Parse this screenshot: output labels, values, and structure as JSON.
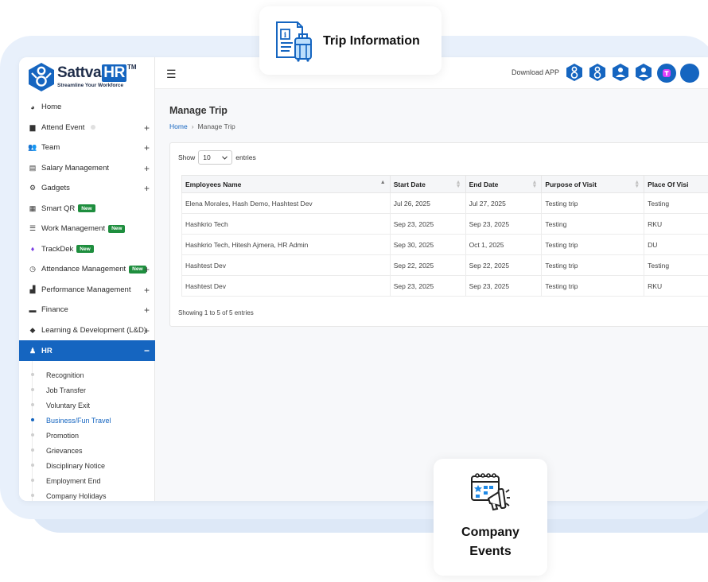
{
  "brand": {
    "name": "Sattva",
    "name_hr": "HR",
    "tm": "TM",
    "tagline": "Streamline Your Workforce"
  },
  "topbar": {
    "download_label": "Download APP"
  },
  "sidebar": {
    "items": [
      {
        "label": "Home",
        "icon": "dashboard-icon",
        "plus": ""
      },
      {
        "label": "Attend Event",
        "icon": "calendar-icon",
        "plus": "+"
      },
      {
        "label": "Team",
        "icon": "users-icon",
        "plus": "+"
      },
      {
        "label": "Salary Management",
        "icon": "document-icon",
        "plus": "+"
      },
      {
        "label": "Gadgets",
        "icon": "gear-icon",
        "plus": "+"
      },
      {
        "label": "Smart QR",
        "icon": "qr-icon",
        "plus": "",
        "badge": "New"
      },
      {
        "label": "Work Management",
        "icon": "list-icon",
        "plus": "",
        "badge": "New"
      },
      {
        "label": "TrackDek",
        "icon": "trackdek-icon",
        "plus": "",
        "badge": "New"
      },
      {
        "label": "Attendance Management",
        "icon": "clock-icon",
        "plus": "+",
        "badge": "New"
      },
      {
        "label": "Performance Management",
        "icon": "chart-icon",
        "plus": "+"
      },
      {
        "label": "Finance",
        "icon": "wallet-icon",
        "plus": "+"
      },
      {
        "label": "Learning & Development (L&D)",
        "icon": "graduation-icon",
        "plus": "+"
      },
      {
        "label": "HR",
        "icon": "user-cog-icon",
        "plus": "−",
        "active": true
      }
    ],
    "hr_sub": [
      "Recognition",
      "Job Transfer",
      "Voluntary Exit",
      "Business/Fun Travel",
      "Promotion",
      "Grievances",
      "Disciplinary Notice",
      "Employment End",
      "Company Holidays"
    ],
    "current_sub": "Business/Fun Travel"
  },
  "main": {
    "title": "Manage Trip",
    "breadcrumb": {
      "home": "Home",
      "sep": "›",
      "current": "Manage Trip"
    },
    "show_label": "Show",
    "entries_value": "10",
    "entries_label": "entries",
    "columns": [
      "Employees Name",
      "Start Date",
      "End Date",
      "Purpose of Visit",
      "Place Of Visi"
    ],
    "rows": [
      [
        "Elena Morales, Hash Demo, Hashtest Dev",
        "Jul 26, 2025",
        "Jul 27, 2025",
        "Testing trip",
        "Testing"
      ],
      [
        "Hashkrio Tech",
        "Sep 23, 2025",
        "Sep 23, 2025",
        "Testing",
        "RKU"
      ],
      [
        "Hashkrio Tech, Hitesh Ajmera, HR Admin",
        "Sep 30, 2025",
        "Oct 1, 2025",
        "Testing trip",
        "DU"
      ],
      [
        "Hashtest Dev",
        "Sep 22, 2025",
        "Sep 22, 2025",
        "Testing trip",
        "Testing"
      ],
      [
        "Hashtest Dev",
        "Sep 23, 2025",
        "Sep 23, 2025",
        "Testing trip",
        "RKU"
      ]
    ],
    "info": "Showing 1 to 5 of 5 entries"
  },
  "floats": {
    "trip_title": "Trip Information",
    "events_line1": "Company",
    "events_line2": "Events"
  },
  "colors": {
    "accent": "#1565c0",
    "badge": "#1e8e3e",
    "bg_light": "#e8f0fb"
  }
}
